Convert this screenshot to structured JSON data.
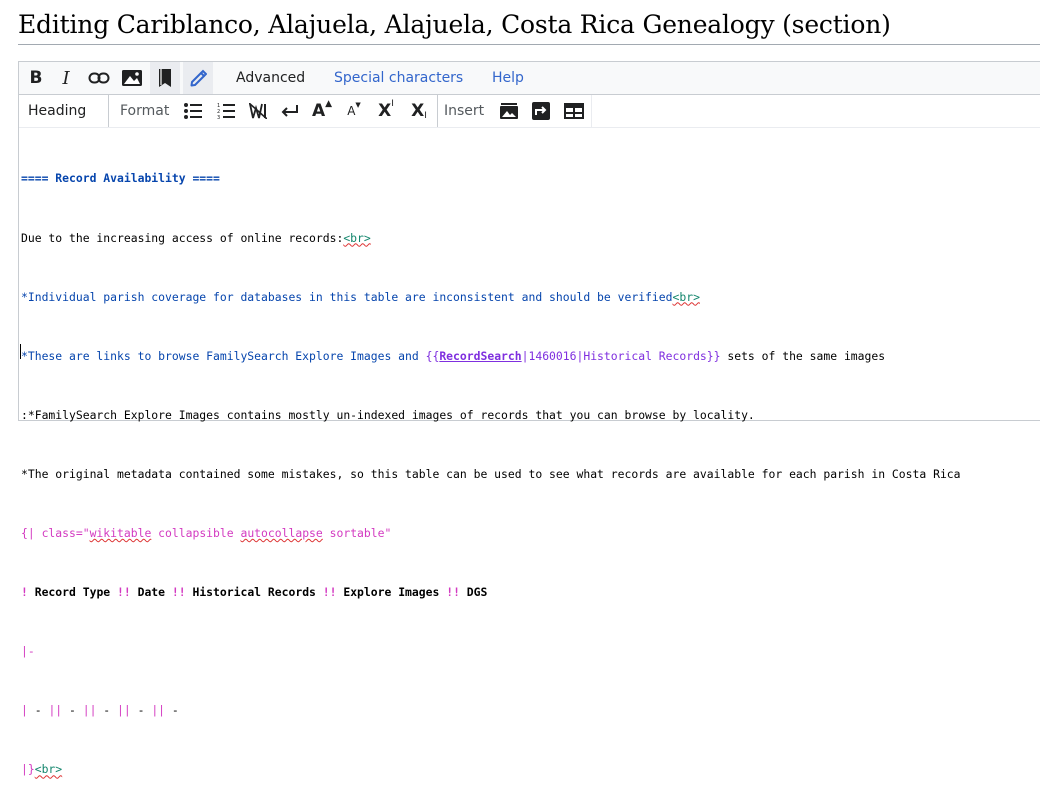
{
  "page": {
    "title": "Editing Cariblanco, Alajuela, Alajuela, Costa Rica Genealogy (section)"
  },
  "toolbar": {
    "bold_label": "B",
    "italic_label": "I",
    "tabs": {
      "advanced": "Advanced",
      "special_characters": "Special characters",
      "help": "Help"
    }
  },
  "advanced_bar": {
    "heading": "Heading",
    "format": "Format",
    "superscript": "X",
    "superscript_mark": "I",
    "subscript": "X",
    "subscript_mark": "I",
    "big": "A",
    "small": "A",
    "insert": "Insert"
  },
  "wikitext": {
    "l1": "==== Record Availability ====",
    "l2a": "Due to the increasing access of online records:",
    "l2b": "<br>",
    "l3a": "*Individual parish coverage for databases in this table are inconsistent and should be verified",
    "l3b": "<br>",
    "l4a": "*These are links to browse FamilySearch Explore Images and ",
    "l4b": "{{",
    "l4c": "RecordSearch",
    "l4d": "|1460016|Historical Records}}",
    "l4e": " sets of the same images",
    "l5": ":*FamilySearch Explore Images contains mostly un-indexed images of records that you can browse by locality.",
    "l6": "*The original metadata contained some mistakes, so this table can be used to see what records are available for each parish in Costa Rica",
    "l7a": "{| class=\"",
    "l7b": "wikitable",
    "l7c": " collapsible ",
    "l7d": "autocollapse",
    "l7e": " sortable\"",
    "l8a": "! ",
    "l8b": "Record Type ",
    "l8c": "!!",
    "l8d": " Date ",
    "l8e": "!!",
    "l8f": " Historical Records ",
    "l8g": "!!",
    "l8h": " Explore Images ",
    "l8i": "!!",
    "l8j": " DGS",
    "l9": "|-",
    "l10a": "| ",
    "l10b": "- ",
    "l10c": "||",
    "l10d": " - ",
    "l10e": "||",
    "l10f": " - ",
    "l10g": "||",
    "l10h": " - ",
    "l10i": "||",
    "l10j": " -",
    "l11a": "|}",
    "l11b": "<br>"
  },
  "colors": {
    "link": "#3366cc",
    "template": "#7f2fdf",
    "table_markup": "#d33ac1",
    "html_tag": "#14866d",
    "border": "#c8ccd1"
  }
}
